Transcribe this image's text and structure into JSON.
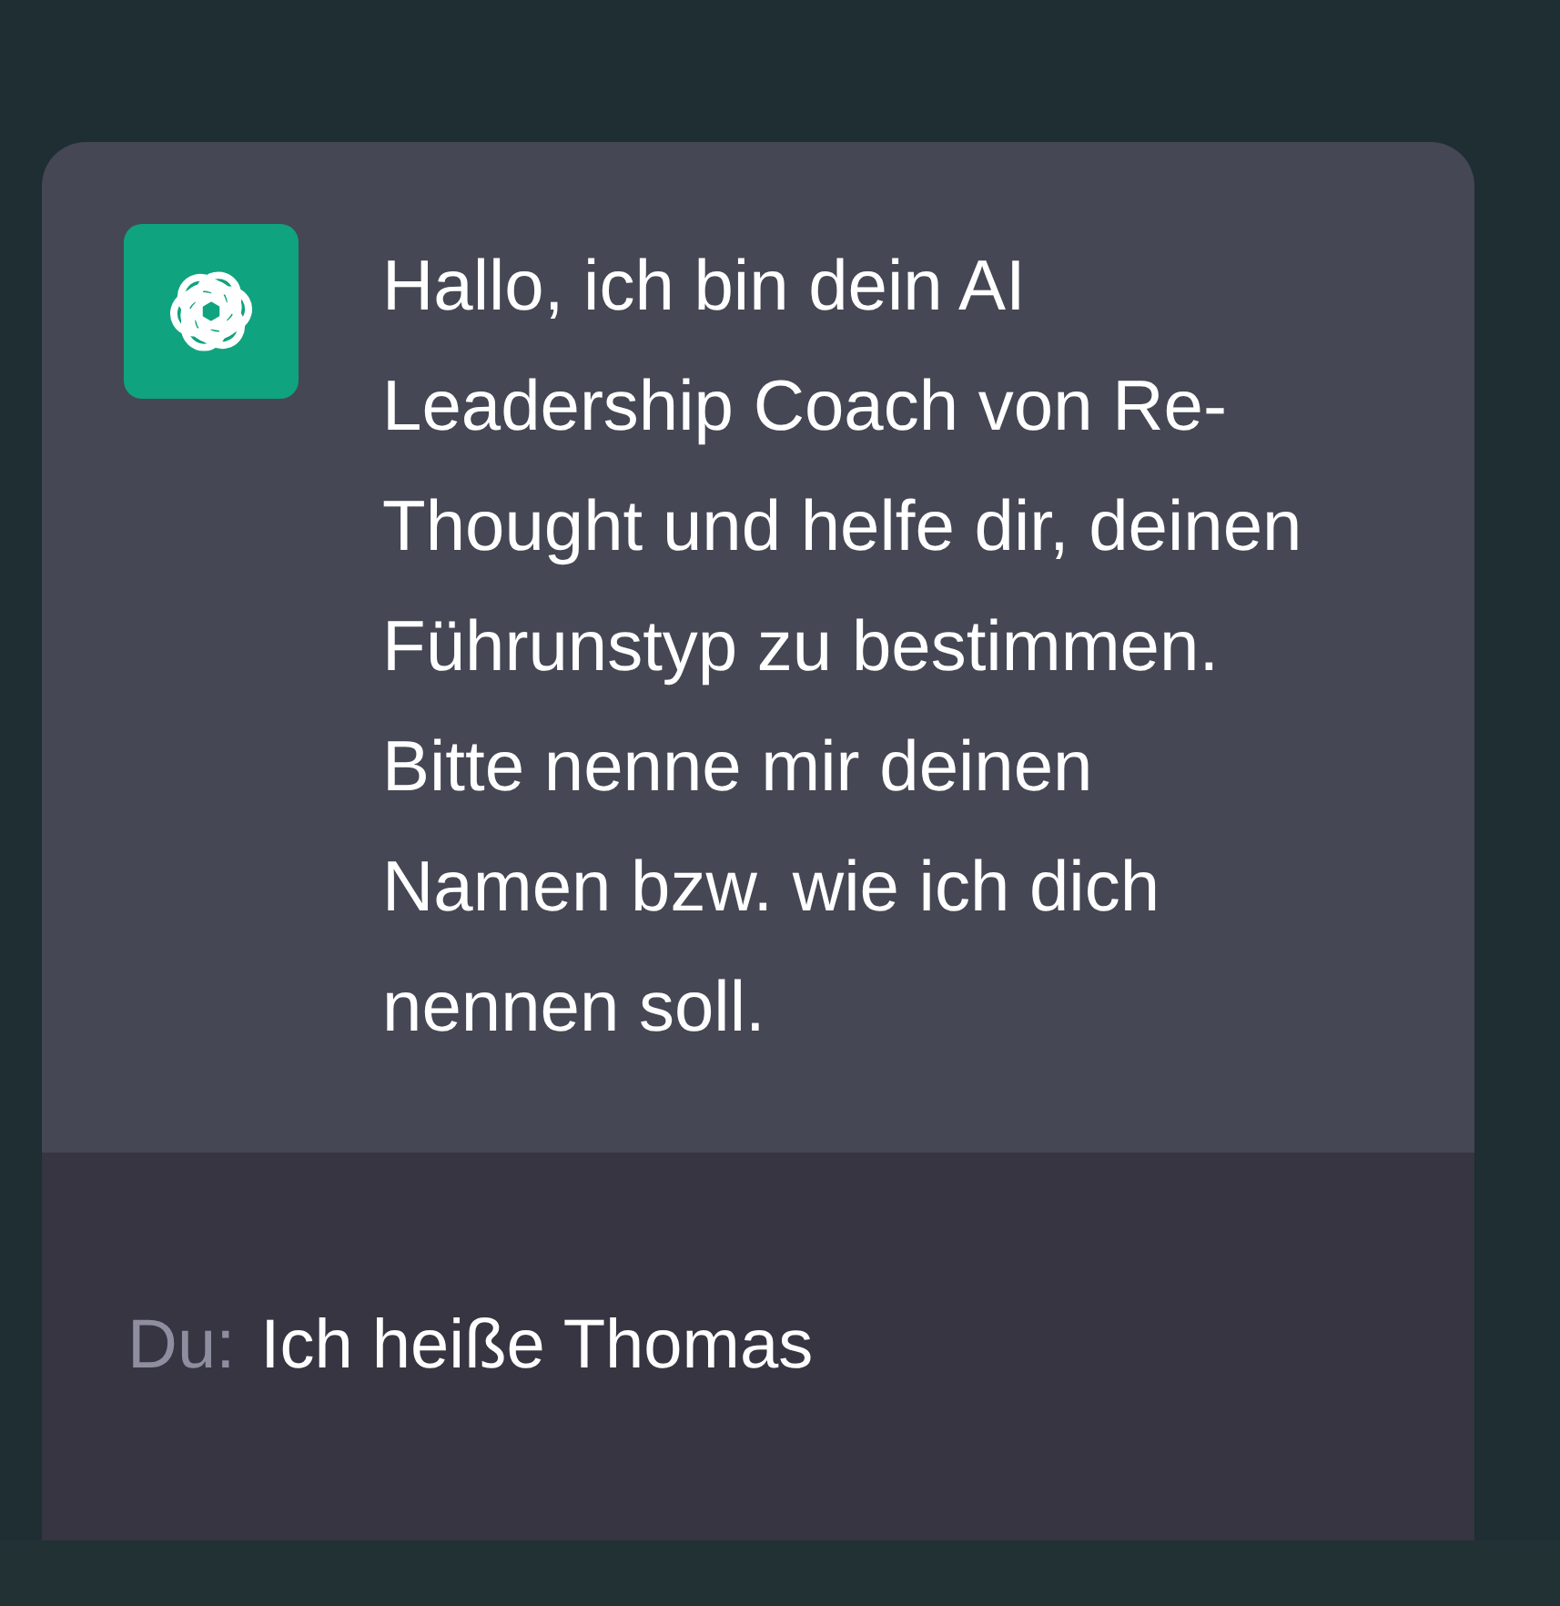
{
  "message": {
    "text": "Hallo, ich bin dein AI Leadership Coach von Re-Thought und helfe dir, deinen Führunstyp zu bestimmen. Bitte nenne mir deinen Namen bzw. wie ich dich nennen soll."
  },
  "reply": {
    "prefix": "Du:",
    "text": "Ich heiße Thomas"
  }
}
